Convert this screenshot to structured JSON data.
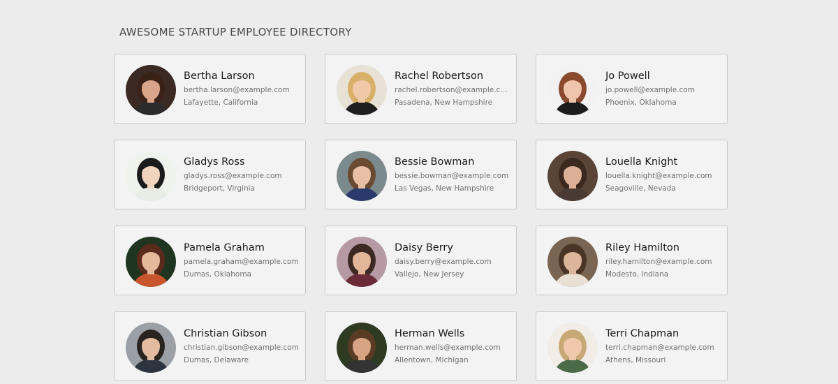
{
  "header": {
    "title": "AWESOME STARTUP EMPLOYEE DIRECTORY"
  },
  "employees": [
    {
      "name": "Bertha Larson",
      "email": "bertha.larson@example.com",
      "location": "Lafayette, California",
      "avatar": {
        "bg": "#3b2a24",
        "skin": "#d9a58a",
        "hair": "#3a2218",
        "shirt": "#2b2b2b"
      }
    },
    {
      "name": "Rachel Robertson",
      "email": "rachel.robertson@example.com",
      "location": "Pasadena, New Hampshire",
      "avatar": {
        "bg": "#e8e2d6",
        "skin": "#f0c9a8",
        "hair": "#d8b06a",
        "shirt": "#1f1f1f"
      }
    },
    {
      "name": "Jo Powell",
      "email": "jo.powell@example.com",
      "location": "Phoenix, Oklahoma",
      "avatar": {
        "bg": "#f2f2f2",
        "skin": "#efc6ad",
        "hair": "#8a4a2e",
        "shirt": "#1c1c1c"
      }
    },
    {
      "name": "Gladys Ross",
      "email": "gladys.ross@example.com",
      "location": "Bridgeport, Virginia",
      "avatar": {
        "bg": "#f0f2ec",
        "skin": "#f1d4bd",
        "hair": "#1b1b1b",
        "shirt": "#e9ece4"
      }
    },
    {
      "name": "Bessie Bowman",
      "email": "bessie.bowman@example.com",
      "location": "Las Vegas, New Hampshire",
      "avatar": {
        "bg": "#7b8a8c",
        "skin": "#e7c0a5",
        "hair": "#6b4a32",
        "shirt": "#2a3a6a"
      }
    },
    {
      "name": "Louella Knight",
      "email": "louella.knight@example.com",
      "location": "Seagoville, Nevada",
      "avatar": {
        "bg": "#5a4438",
        "skin": "#dcb096",
        "hair": "#3b281e",
        "shirt": "#4a3a34"
      }
    },
    {
      "name": "Pamela Graham",
      "email": "pamela.graham@example.com",
      "location": "Dumas, Oklahoma",
      "avatar": {
        "bg": "#1f3520",
        "skin": "#e4b89a",
        "hair": "#5a2a1c",
        "shirt": "#c8552c"
      }
    },
    {
      "name": "Daisy Berry",
      "email": "daisy.berry@example.com",
      "location": "Vallejo, New Jersey",
      "avatar": {
        "bg": "#b69aa3",
        "skin": "#e2b699",
        "hair": "#3c2a22",
        "shirt": "#6a2a38"
      }
    },
    {
      "name": "Riley Hamilton",
      "email": "riley.hamilton@example.com",
      "location": "Modesto, Indiana",
      "avatar": {
        "bg": "#7a6452",
        "skin": "#dcb59a",
        "hair": "#4a3426",
        "shirt": "#e8e0d2"
      }
    },
    {
      "name": "Christian Gibson",
      "email": "christian.gibson@example.com",
      "location": "Dumas, Delaware",
      "avatar": {
        "bg": "#9aa0a6",
        "skin": "#e3bba0",
        "hair": "#2a2420",
        "shirt": "#2c3440"
      }
    },
    {
      "name": "Herman Wells",
      "email": "herman.wells@example.com",
      "location": "Allentown, Michigan",
      "avatar": {
        "bg": "#2e3a22",
        "skin": "#d8a584",
        "hair": "#5a3c24",
        "shirt": "#333333"
      }
    },
    {
      "name": "Terri Chapman",
      "email": "terri.chapman@example.com",
      "location": "Athens, Missouri",
      "avatar": {
        "bg": "#f2ece6",
        "skin": "#f0c8ac",
        "hair": "#c9a878",
        "shirt": "#4a6a48"
      }
    }
  ]
}
